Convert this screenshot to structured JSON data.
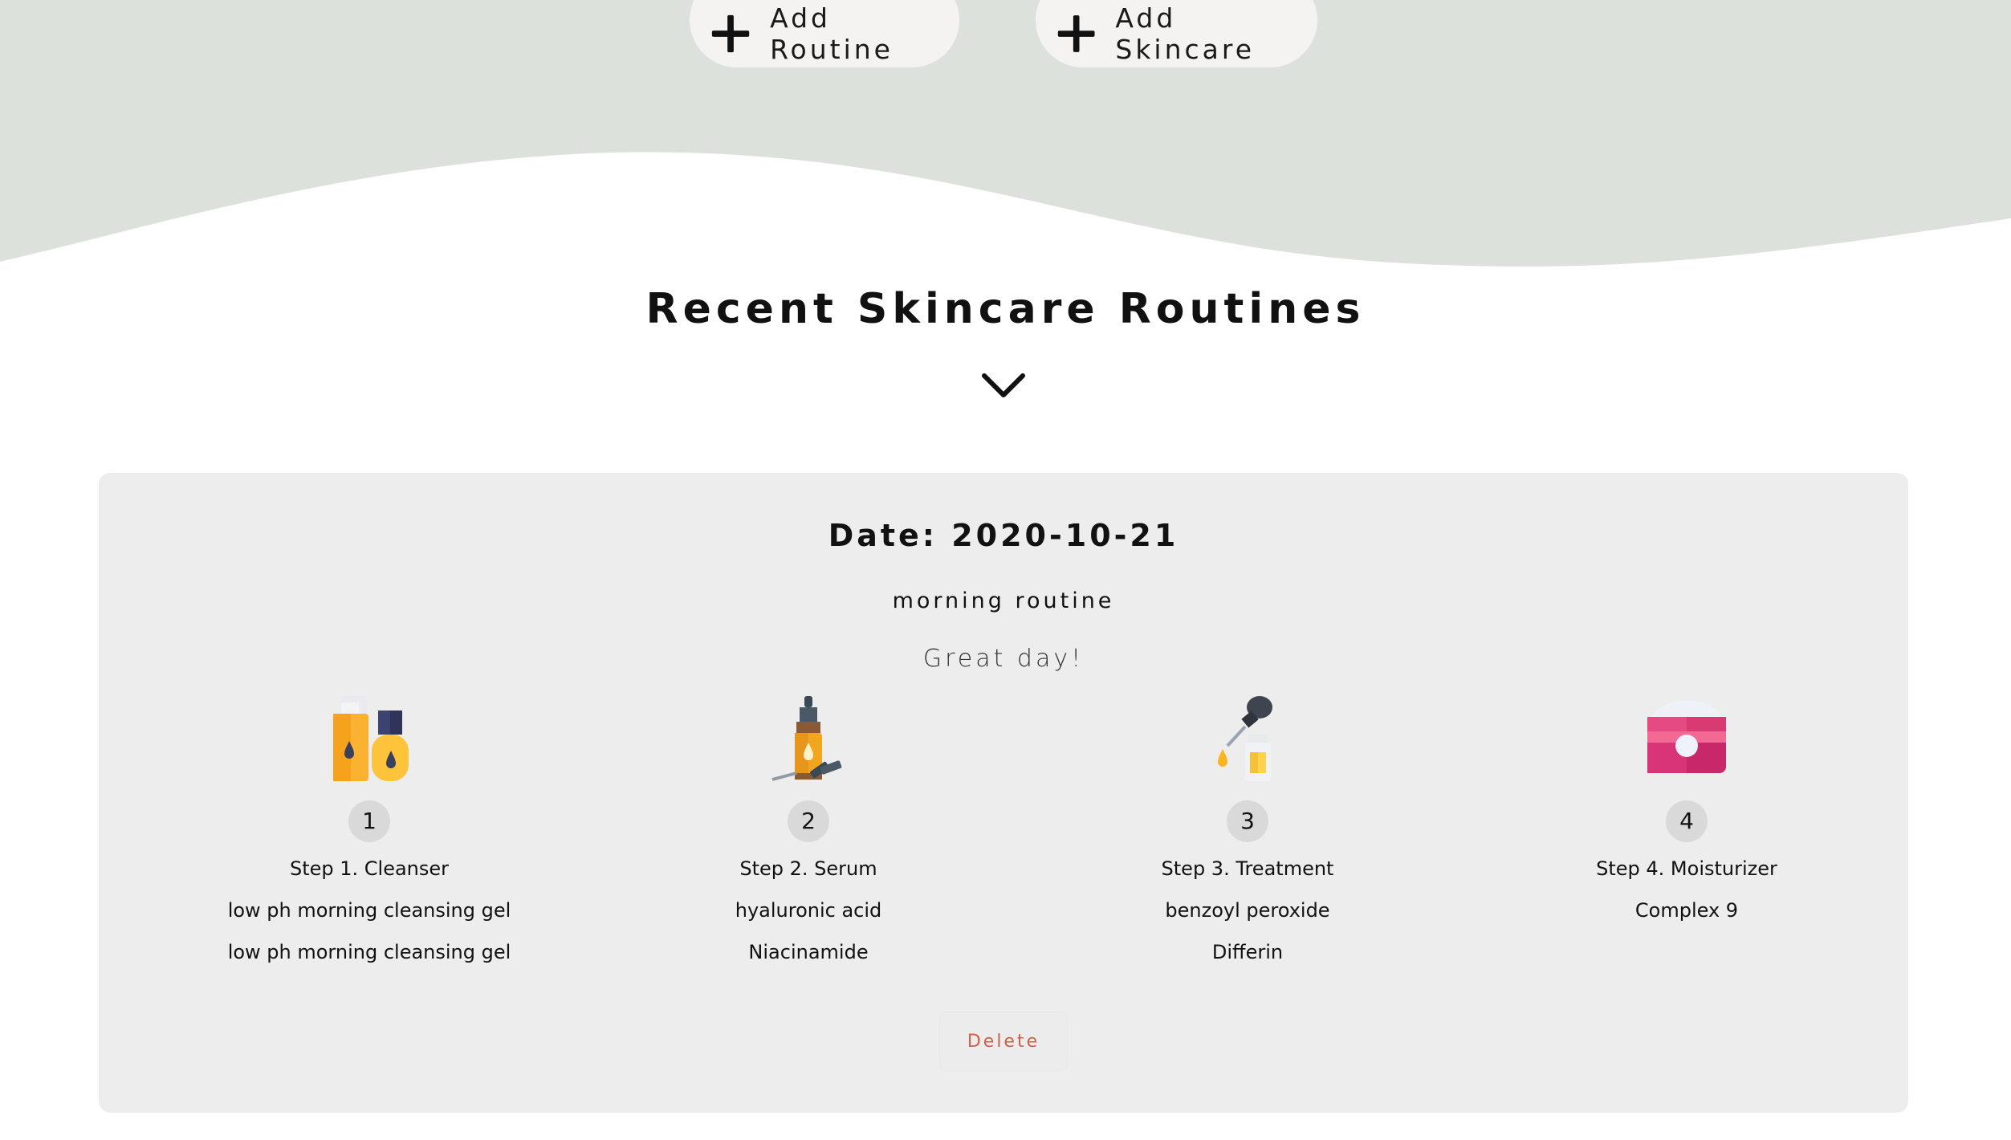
{
  "actions": {
    "add_routine_label": "Add Routine",
    "add_skincare_label": "Add Skincare"
  },
  "colors": {
    "hero_bg": "#dde1dc",
    "card_bg": "#ededed",
    "delete_text": "#d0604a"
  },
  "section": {
    "title": "Recent Skincare Routines",
    "expand_icon": "chevron-down-icon"
  },
  "routines": [
    {
      "date_text": "Date: 2020-10-21",
      "type": "morning routine",
      "note": "Great day!",
      "delete_label": "Delete",
      "steps": [
        {
          "number": "1",
          "title": "Step 1. Cleanser",
          "icon": "cleanser-bottles-icon",
          "products": [
            "low ph morning cleansing gel",
            "low ph morning cleansing gel"
          ]
        },
        {
          "number": "2",
          "title": "Step 2. Serum",
          "icon": "serum-dropper-bottle-icon",
          "products": [
            "hyaluronic acid",
            "Niacinamide"
          ]
        },
        {
          "number": "3",
          "title": "Step 3. Treatment",
          "icon": "treatment-dropper-icon",
          "products": [
            "benzoyl peroxide",
            "Differin"
          ]
        },
        {
          "number": "4",
          "title": "Step 4. Moisturizer",
          "icon": "moisturizer-jar-icon",
          "products": [
            "Complex 9"
          ]
        }
      ]
    }
  ]
}
